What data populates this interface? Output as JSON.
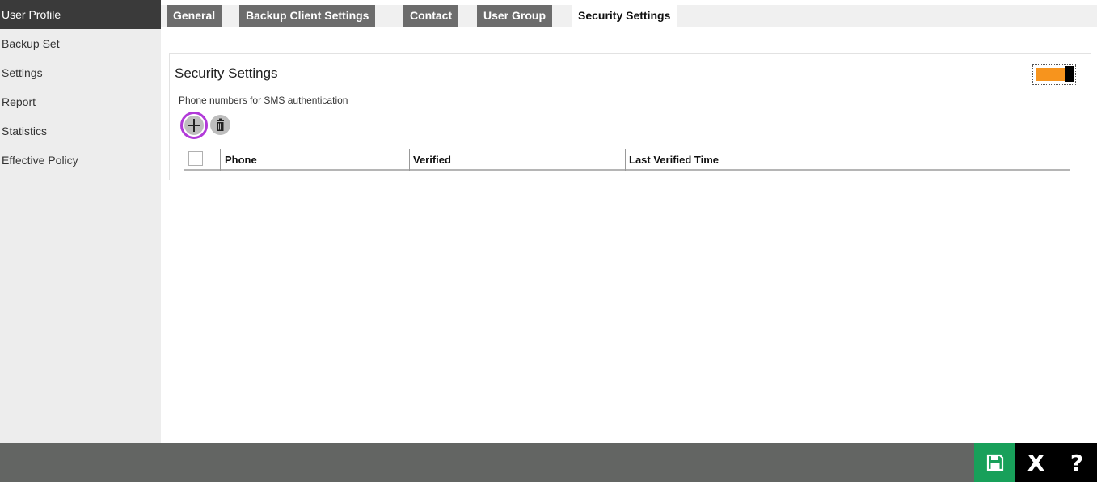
{
  "sidebar": {
    "items": [
      {
        "label": "User Profile",
        "active": true
      },
      {
        "label": "Backup Set",
        "active": false
      },
      {
        "label": "Settings",
        "active": false
      },
      {
        "label": "Report",
        "active": false
      },
      {
        "label": "Statistics",
        "active": false
      },
      {
        "label": "Effective Policy",
        "active": false
      }
    ]
  },
  "tabs": [
    {
      "label": "General",
      "active": false
    },
    {
      "label": "Backup Client Settings",
      "active": false
    },
    {
      "label": "Contact",
      "active": false
    },
    {
      "label": "User Group",
      "active": false
    },
    {
      "label": "Security Settings",
      "active": true
    }
  ],
  "panel": {
    "title": "Security Settings",
    "subtitle": "Phone numbers for SMS authentication",
    "toggle": {
      "state": "on",
      "color": "#f7941d"
    }
  },
  "table": {
    "columns": [
      "Phone",
      "Verified",
      "Last Verified Time"
    ],
    "rows": []
  },
  "icons": {
    "add": "plus-icon",
    "delete": "trash-icon",
    "save": "floppy-disk-icon",
    "close": "close-icon",
    "help": "question-icon"
  },
  "footer": {
    "close_glyph": "X",
    "help_glyph": "?"
  },
  "colors": {
    "accent_purple": "#b13ad8",
    "save_green": "#18a05a",
    "bottombar": "#636563",
    "tab_inactive": "#6c6c6c",
    "sidebar_active": "#3a3a3a"
  }
}
